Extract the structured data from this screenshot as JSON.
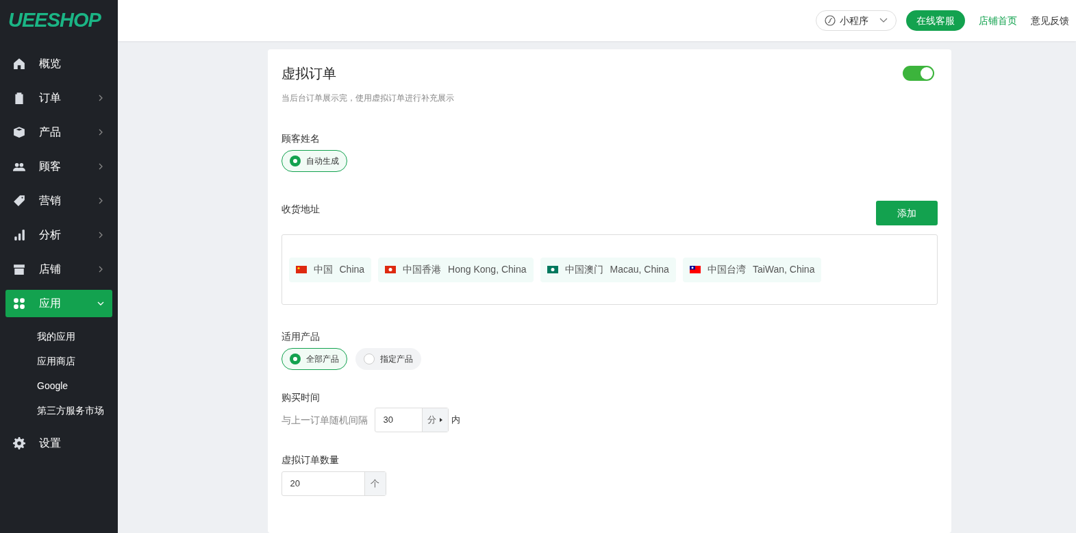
{
  "logo": "UEESHOP",
  "sidebar": {
    "items": [
      {
        "kind": "home",
        "label": "概览",
        "selected": false
      },
      {
        "kind": "order",
        "label": "订单",
        "selected": false,
        "expanded": false
      },
      {
        "kind": "product",
        "label": "产品",
        "selected": false,
        "expanded": false
      },
      {
        "kind": "customer",
        "label": "顾客",
        "selected": false,
        "expanded": false
      },
      {
        "kind": "marketing",
        "label": "营销",
        "selected": false,
        "expanded": false
      },
      {
        "kind": "analytics",
        "label": "分析",
        "selected": false,
        "expanded": false
      },
      {
        "kind": "store",
        "label": "店铺",
        "selected": false,
        "expanded": false
      },
      {
        "kind": "apps",
        "label": "应用",
        "selected": true,
        "expanded": true,
        "children": [
          {
            "label": "我的应用"
          },
          {
            "label": "应用商店"
          },
          {
            "label": "Google"
          },
          {
            "label": "第三方服务市场"
          }
        ]
      },
      {
        "kind": "settings",
        "label": "设置",
        "selected": false
      }
    ]
  },
  "header": {
    "mini_program": "小程序",
    "service_button": "在线客服",
    "links": [
      {
        "label": "店铺首页",
        "selected": true
      },
      {
        "label": "意见反馈",
        "selected": false
      }
    ]
  },
  "card": {
    "title": "虚拟订单",
    "on": true,
    "description": "当后台订单展示完，使用虚拟订单进行补充展示",
    "customer_name": {
      "label": "顾客姓名",
      "options": [
        {
          "label": "自动生成",
          "selected": true
        }
      ]
    },
    "address": {
      "label": "收货地址",
      "add_button": "添加",
      "tags": [
        {
          "kind": "cn",
          "name": "中国",
          "english": "China"
        },
        {
          "kind": "hk",
          "name": "中国香港",
          "english": "Hong Kong, China"
        },
        {
          "kind": "mo",
          "name": "中国澳门",
          "english": "Macau, China"
        },
        {
          "kind": "tw",
          "name": "中国台湾",
          "english": "TaiWan, China"
        }
      ]
    },
    "products": {
      "label": "适用产品",
      "options": [
        {
          "label": "全部产品",
          "selected": true
        },
        {
          "label": "指定产品",
          "selected": false
        }
      ]
    },
    "purchase_time": {
      "label": "购买时间",
      "prefix": "与上一订单随机间隔",
      "value": "30",
      "unit": "分",
      "suffix": "内"
    },
    "count": {
      "label": "虚拟订单数量",
      "value": "20",
      "unit": "个"
    }
  }
}
